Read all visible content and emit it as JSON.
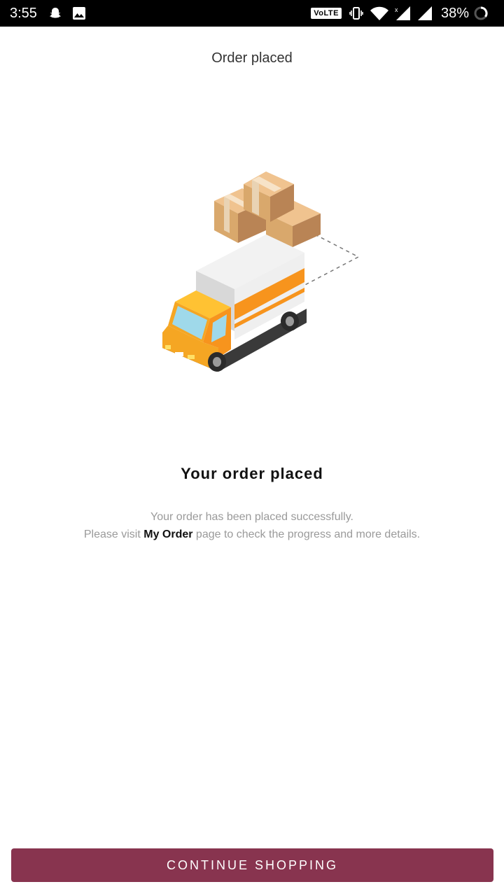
{
  "status_bar": {
    "time": "3:55",
    "network_badge": "VoLTE",
    "battery_percent": "38%",
    "icons": [
      "snapchat-ghost-icon",
      "image-icon",
      "vibrate-icon",
      "wifi-icon",
      "signal-icon",
      "battery-ring-icon"
    ]
  },
  "header": {
    "title": "Order placed"
  },
  "illustration": {
    "icon": "delivery-truck-with-boxes",
    "colors": {
      "truck_body": "#f5a623",
      "cargo": "#efefef",
      "stripe": "#f7941d",
      "box": "#d9a86c"
    }
  },
  "content": {
    "title": "Your order placed",
    "message_line1": "Your order has been placed successfully.",
    "message_line2_prefix": "Please visit ",
    "message_link": "My Order",
    "message_line2_suffix": " page to check the progress and more details."
  },
  "actions": {
    "continue_label": "CONTINUE SHOPPING",
    "accent_color": "#88344f"
  }
}
